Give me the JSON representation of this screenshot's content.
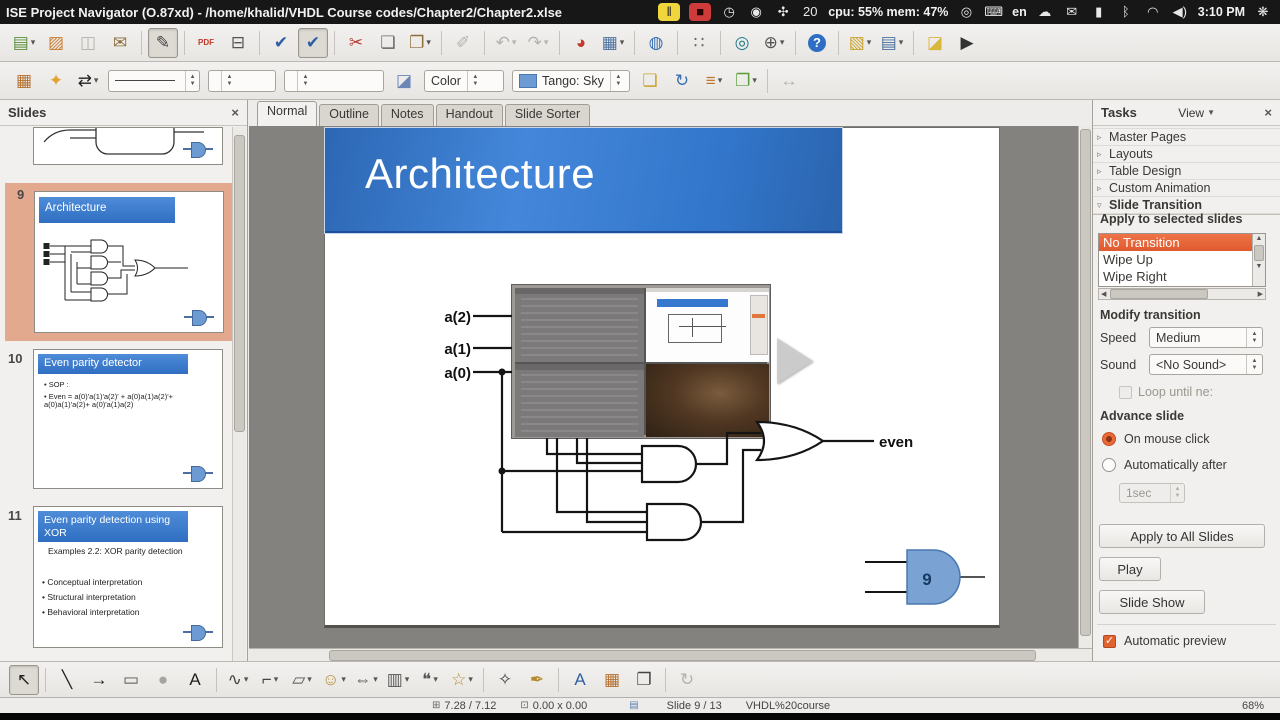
{
  "system_bar": {
    "window_title": "ISE Project Navigator (O.87xd) - /home/khalid/VHDL Course codes/Chapter2/Chapter2.xlse",
    "tray": [
      {
        "name": "pause",
        "glyph": "‖",
        "hl": "#f0d63c"
      },
      {
        "name": "stop",
        "glyph": "■",
        "hl": "#cf3b3b",
        "fg": "#2a0000"
      },
      {
        "name": "clock",
        "glyph": "◷"
      },
      {
        "name": "indicator",
        "glyph": "◉"
      },
      {
        "name": "workspace",
        "glyph": "✣"
      },
      {
        "name": "calendar",
        "glyph": "20"
      },
      {
        "name": "cpu-mem-indicator",
        "text": "cpu: 55% mem: 47%"
      },
      {
        "name": "settings",
        "glyph": "◎"
      },
      {
        "name": "keyboard",
        "glyph": "⌨"
      },
      {
        "name": "keyboard-layout",
        "text": "en"
      },
      {
        "name": "cloud",
        "glyph": "☁"
      },
      {
        "name": "mail",
        "glyph": "✉"
      },
      {
        "name": "battery",
        "glyph": "▮"
      },
      {
        "name": "bluetooth",
        "glyph": "ᛒ"
      },
      {
        "name": "wifi",
        "glyph": "◠"
      },
      {
        "name": "volume",
        "glyph": "◀)"
      },
      {
        "name": "time",
        "text": "3:10 PM"
      },
      {
        "name": "session-menu",
        "glyph": "❋"
      }
    ]
  },
  "toolbar_standard": [
    {
      "name": "new-presentation",
      "glyph": "▤",
      "color": "#5a8f3d",
      "dd": true
    },
    {
      "name": "open",
      "glyph": "▨",
      "color": "#c97b2e"
    },
    {
      "name": "save",
      "glyph": "◫",
      "color": "#b5b2ad",
      "disabled": true
    },
    {
      "name": "email-document",
      "glyph": "✉",
      "color": "#8a6d3b"
    },
    {
      "sep": true
    },
    {
      "name": "edit-file",
      "glyph": "✎",
      "color": "#444",
      "pressed": true
    },
    {
      "sep": true
    },
    {
      "name": "export-pdf",
      "glyph": "PDF",
      "color": "#c0392b"
    },
    {
      "name": "print",
      "glyph": "⊟",
      "color": "#555"
    },
    {
      "sep": true
    },
    {
      "name": "spelling",
      "glyph": "✔",
      "color": "#2e5fa3"
    },
    {
      "name": "auto-spellcheck",
      "glyph": "✔",
      "color": "#2e5fa3",
      "pressed": true
    },
    {
      "sep": true
    },
    {
      "name": "cut",
      "glyph": "✂",
      "color": "#b23b2e"
    },
    {
      "name": "copy",
      "glyph": "❏",
      "color": "#666"
    },
    {
      "name": "paste",
      "glyph": "❐",
      "color": "#8a6d3b",
      "dd": true
    },
    {
      "sep": true
    },
    {
      "name": "clone-formatting",
      "glyph": "✐",
      "color": "#b5b2ad",
      "disabled": true
    },
    {
      "sep": true
    },
    {
      "name": "undo",
      "glyph": "↶",
      "color": "#b5b2ad",
      "disabled": true,
      "dd": true
    },
    {
      "name": "redo",
      "glyph": "↷",
      "color": "#b5b2ad",
      "disabled": true,
      "dd": true
    },
    {
      "sep": true
    },
    {
      "name": "insert-chart",
      "glyph": "◕",
      "color": "#c0392b"
    },
    {
      "name": "insert-table",
      "glyph": "▦",
      "color": "#4a6f9e",
      "dd": true
    },
    {
      "sep": true
    },
    {
      "name": "hyperlink",
      "glyph": "◍",
      "color": "#3a6fb0"
    },
    {
      "sep": true
    },
    {
      "name": "display-grid",
      "glyph": "∷",
      "color": "#666"
    },
    {
      "sep": true
    },
    {
      "name": "navigator",
      "glyph": "◎",
      "color": "#1f7a8c"
    },
    {
      "name": "zoom",
      "glyph": "⊕",
      "color": "#555",
      "dd": true
    },
    {
      "sep": true
    },
    {
      "name": "help",
      "glyph": "?",
      "color": "#fff",
      "bg": "#2e6fc4"
    },
    {
      "sep": true
    },
    {
      "name": "insert-slide",
      "glyph": "▧",
      "color": "#c9a32e",
      "dd": true
    },
    {
      "name": "slide-layout",
      "glyph": "▤",
      "color": "#4a6f9e",
      "dd": true
    },
    {
      "sep": true
    },
    {
      "name": "master-page",
      "glyph": "◪",
      "color": "#d9b73a"
    },
    {
      "name": "start-presentation",
      "glyph": "▶",
      "color": "#333"
    }
  ],
  "toolbar_line": {
    "group_a": [
      {
        "name": "snap-grid",
        "glyph": "▦",
        "color": "#b5702e"
      },
      {
        "name": "helplines",
        "glyph": "✦",
        "color": "#e0a52f"
      },
      {
        "name": "arrow-style",
        "glyph": "⇄",
        "color": "#222",
        "dd": true
      }
    ],
    "group_b": [
      {
        "name": "area-style",
        "glyph": "◪",
        "color": "#6a87b5"
      }
    ],
    "group_c": [
      {
        "name": "shadow",
        "glyph": "❏",
        "color": "#c9a32e"
      },
      {
        "name": "rotate-object",
        "glyph": "↻",
        "color": "#3a6fb0"
      },
      {
        "name": "alignment",
        "glyph": "≡",
        "color": "#c07830",
        "dd": true
      },
      {
        "name": "arrange",
        "glyph": "❐",
        "color": "#5a9e3a",
        "dd": true
      },
      {
        "sep": true
      },
      {
        "name": "optimize",
        "glyph": "↔",
        "color": "#b5b2ad",
        "disabled": true
      }
    ],
    "fill_type_value": "Color",
    "fill_color_value": "Tango: Sky"
  },
  "toolbar_drawing": [
    {
      "name": "select",
      "glyph": "↖",
      "color": "#222",
      "pressed": true
    },
    {
      "sep": true
    },
    {
      "name": "line",
      "glyph": "╲",
      "color": "#222"
    },
    {
      "name": "line-arrow-end",
      "glyph": "→",
      "color": "#222"
    },
    {
      "name": "rectangle",
      "glyph": "▭",
      "color": "#555"
    },
    {
      "name": "ellipse",
      "glyph": "●",
      "color": "#a8a5a0"
    },
    {
      "name": "text-box",
      "glyph": "A",
      "color": "#222"
    },
    {
      "sep": true
    },
    {
      "name": "curve",
      "glyph": "∿",
      "color": "#444",
      "dd": true
    },
    {
      "name": "connector",
      "glyph": "⌐",
      "color": "#444",
      "dd": true
    },
    {
      "name": "basic-shapes",
      "glyph": "▱",
      "color": "#555",
      "dd": true
    },
    {
      "name": "symbol-shapes",
      "glyph": "☺",
      "color": "#b58a2e",
      "dd": true
    },
    {
      "name": "block-arrows",
      "glyph": "⇔",
      "color": "#555",
      "dd": true
    },
    {
      "name": "flowchart",
      "glyph": "▥",
      "color": "#555",
      "dd": true
    },
    {
      "name": "callouts",
      "glyph": "❝",
      "color": "#555",
      "dd": true
    },
    {
      "name": "stars",
      "glyph": "☆",
      "color": "#b58a2e",
      "dd": true
    },
    {
      "sep": true
    },
    {
      "name": "points",
      "glyph": "✧",
      "color": "#444"
    },
    {
      "name": "glue-points",
      "glyph": "✒",
      "color": "#b58a2e"
    },
    {
      "sep": true
    },
    {
      "name": "fontwork",
      "glyph": "A",
      "color": "#2e5fa3"
    },
    {
      "name": "insert-image",
      "glyph": "▦",
      "color": "#b5702e"
    },
    {
      "name": "gallery",
      "glyph": "❐",
      "color": "#444"
    },
    {
      "sep": true
    },
    {
      "name": "toggle-rotate",
      "glyph": "↻",
      "color": "#b5b2ad",
      "disabled": true
    }
  ],
  "view_tabs": [
    {
      "name": "normal",
      "label": "Normal",
      "active": true
    },
    {
      "name": "outline",
      "label": "Outline"
    },
    {
      "name": "notes",
      "label": "Notes"
    },
    {
      "name": "handout",
      "label": "Handout"
    },
    {
      "name": "slide-sorter",
      "label": "Slide Sorter"
    }
  ],
  "slides_panel": {
    "title": "Slides",
    "close_glyph": "×",
    "slides": [
      {
        "number": ""
      },
      {
        "number": "9",
        "title": "Architecture",
        "selected": true
      },
      {
        "number": "10",
        "title": "Even parity detector",
        "bullets": [
          "SOP :",
          "Even = a(0)'a(1)'a(2)' + a(0)a(1)a(2)'+ a(0)a(1)'a(2)+ a(0)'a(1)a(2)"
        ]
      },
      {
        "number": "11",
        "title": "Even parity  detection using XOR",
        "subtitle": "Examples 2.2: XOR parity detection",
        "bullets": [
          "Conceptual interpretation",
          "Structural interpretation",
          "Behavioral interpretation"
        ]
      }
    ]
  },
  "slide": {
    "title": "Architecture",
    "input_labels": [
      "a(2)",
      "a(1)",
      "a(0)"
    ],
    "output_label": "even",
    "page_number_shape": "9"
  },
  "tasks_panel": {
    "title": "Tasks",
    "view_label": "View",
    "close_glyph": "×",
    "sections": [
      {
        "name": "master-pages",
        "label": "Master Pages"
      },
      {
        "name": "layouts",
        "label": "Layouts"
      },
      {
        "name": "table-design",
        "label": "Table Design"
      },
      {
        "name": "custom-animation",
        "label": "Custom Animation"
      },
      {
        "name": "slide-transition",
        "label": "Slide Transition",
        "expanded": true
      }
    ],
    "apply_label": "Apply to selected slides",
    "transitions": [
      "No Transition",
      "Wipe Up",
      "Wipe Right"
    ],
    "selected_transition": "No Transition",
    "modify_title": "Modify transition",
    "speed_label": "Speed",
    "speed_value": "Medium",
    "sound_label": "Sound",
    "sound_value": "<No Sound>",
    "loop_label": "Loop until ne:",
    "advance_title": "Advance slide",
    "on_mouse_click_label": "On mouse click",
    "automatically_after_label": "Automatically after",
    "automatically_after_value": "1sec",
    "apply_all_label": "Apply to All Slides",
    "play_label": "Play",
    "slide_show_label": "Slide Show",
    "auto_preview_label": "Automatic preview",
    "auto_preview_checked": true
  },
  "statusbar": {
    "position_icon": "⊞",
    "position": "7.28 / 7.12",
    "size_icon": "⊡",
    "object_size": "0.00 x 0.00",
    "doc_icon": "▤",
    "slide_info": "Slide 9 / 13",
    "template_name": "VHDL%20course",
    "zoom_level": "68%"
  }
}
